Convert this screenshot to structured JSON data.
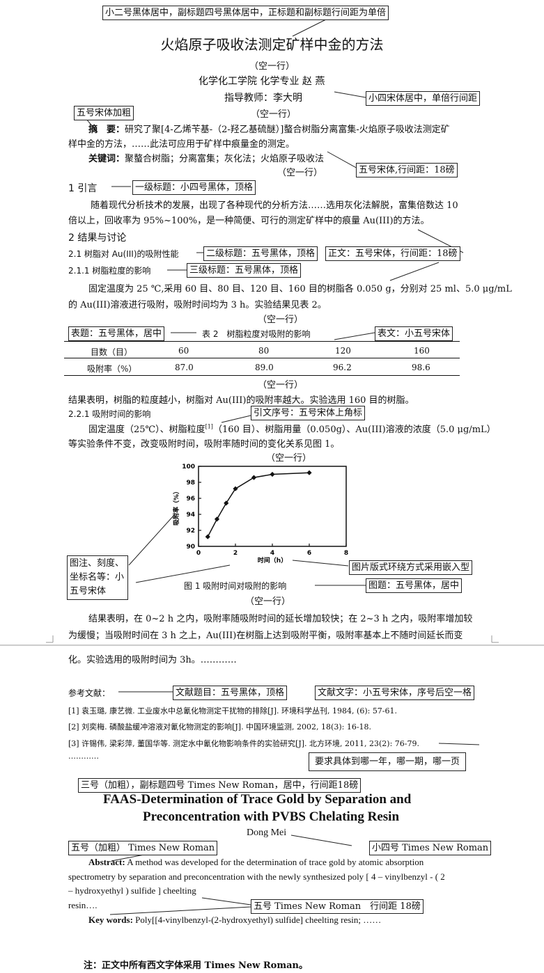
{
  "annotations": {
    "title_style": "小二号黑体居中，副标题四号黑体居中，正标题和副标题行间距为单倍",
    "author_style": "小四宋体居中，单倍行间距",
    "abstract_label_style": "五号宋体加粗",
    "abstract_spacing": "五号宋体,行间距：18磅",
    "level1_heading": "一级标题：小四号黑体，顶格",
    "level2_heading": "二级标题：五号黑体，顶格",
    "body_text_style": "正文：五号宋体，行间距：18磅",
    "level3_heading": "三级标题：五号黑体，顶格",
    "table_title_style": "表题：五号黑体，居中",
    "table_text_style": "表文：小五号宋体",
    "citation_style": "引文序号：五号宋体上角标",
    "figure_label_style": "图注、刻度、坐标名等：小五号宋体",
    "figure_wrap_style": "图片版式环绕方式采用嵌入型",
    "figure_title_style": "图题：五号黑体，居中",
    "ref_title_style": "文献题目：五号黑体，顶格",
    "ref_text_style": "文献文字：小五号宋体，序号后空一格",
    "ref_detail_note": "要求具体到哪一年，哪一期，哪一页",
    "en_title_style": "三号（加粗），副标题四号 Times New Roman，居中，行间距18磅",
    "en_author_style": "小四号 Times New Roman",
    "en_abstract_label_style": "五号（加粗） Times New Roman",
    "en_body_style": "五号 Times New Roman　行间距 18磅"
  },
  "title": "火焰原子吸收法测定矿样中金的方法",
  "blank_line": "（空一行）",
  "affiliation": "化学化工学院  化学专业  赵    燕",
  "advisor": "指导教师：李大明",
  "abstract_label": "摘　要：",
  "abstract_text_1": "研究了聚[4-乙烯苄基-（2-羟乙基硫醚）]螯合树脂分离富集-火焰原子吸收法测定矿",
  "abstract_text_2": "样中金的方法，……此法可应用于矿样中痕量金的测定。",
  "keywords_label": "关键词：",
  "keywords_text": "聚螯合树脂；分离富集；灰化法；火焰原子吸收法",
  "sec1_heading": "1 引言",
  "intro_1": "随着现代分析技术的发展，出现了各种现代的分析方法……选用灰化法解脱，富集倍数达 10",
  "intro_2": "倍以上，回收率为 95%~100%，是一种简便、可行的测定矿样中的痕量 Au(III)的方法。",
  "sec2_heading": "2 结果与讨论",
  "sec21_heading": "2.1 树脂对 Au(III)的吸附性能",
  "sec211_heading": "2.1.1 树脂粒度的影响",
  "p211_1": "固定温度为 25 ℃,采用 60 目、80 目、120 目、160 目的树脂各 0.050 g，分别对 25 ml、5.0 μg/mL",
  "p211_2": "的 Au(III)溶液进行吸附，吸附时间均为 3 h。实验结果见表 2。",
  "table": {
    "caption": "表 2　树脂粒度对吸附的影响",
    "row1_label": "目数（目）",
    "row1": [
      "60",
      "80",
      "120",
      "160"
    ],
    "row2_label": "吸附率（%）",
    "row2": [
      "87.0",
      "89.0",
      "96.2",
      "98.6"
    ]
  },
  "result_211": "结果表明，树脂的粒度越小，树脂对 Au(III)的吸附率越大。实验选用 160 目的树脂。",
  "sec221_heading": "2.2.1 吸附时间的影响",
  "p221_1": "固定温度（25℃）、树脂粒度",
  "p221_cite": "[1]",
  "p221_1b": "（160 目）、树脂用量（0.050g）、Au(III)溶液的浓度（5.0 μg/mL）",
  "p221_2": "等实验条件不变，改变吸附时间，吸附率随时间的变化关系见图 1。",
  "chart_data": {
    "type": "line",
    "x": [
      0.5,
      1,
      1.5,
      2,
      3,
      4,
      6
    ],
    "y": [
      91.2,
      93.4,
      95.4,
      97.2,
      98.6,
      99.0,
      99.2
    ],
    "xlabel": "时间（h）",
    "ylabel": "吸附率（%）",
    "xlim": [
      0,
      8
    ],
    "ylim": [
      90,
      100
    ],
    "xticks": [
      "0",
      "2",
      "4",
      "6",
      "8"
    ],
    "yticks": [
      "90",
      "92",
      "94",
      "96",
      "98",
      "100"
    ],
    "marker": "diamond",
    "grid": false
  },
  "figure_caption": "图 1  吸附时间对吸附的影响",
  "result_221_1": "结果表明，在 0~2 h 之内，吸附率随吸附时间的延长增加较快；在 2~3 h 之内，吸附率增加较",
  "result_221_2": "为缓慢；当吸附时间在 3 h 之上，Au(III)在树脂上达到吸附平衡，吸附率基本上不随时间延长而变",
  "result_221_3": "化。实验选用的吸附时间为 3h。…………",
  "refs_label": "参考文献：",
  "refs": [
    "[1]  袁玉璐, 康艺微. 工业废水中总氰化物测定干扰物的排除[J]. 环境科学丛刊, 1984, (6): 57-61.",
    "[2]  刘奕梅. 磷酸盐缓冲溶液对氰化物测定的影响[J]. 中国环境监测, 2002, 18(3): 16-18.",
    "[3]  许锡伟, 梁彩萍, 董国华等. 测定水中氰化物影响条件的实验研究[J]. 北方环境, 2011, 23(2): 76-79."
  ],
  "refs_ellipsis": "…………",
  "en_title_1": "FAAS-Determination of Trace Gold by Separation and",
  "en_title_2": "Preconcentration with PVBS Chelating Resin",
  "en_author": "Dong Mei",
  "en_abstract_label": "Abstract:",
  "en_abstract_1": "A method was developed for the determination of trace gold by atomic absorption",
  "en_abstract_2": "spectrometry by separation and preconcentration with the   newly synthesized poly [ 4 – vinylbenzyl - ( 2",
  "en_abstract_3": "– hydroxyethyl )   sulfide ]   cheelting",
  "en_abstract_4": "resin….",
  "en_keywords_label": "Key words:",
  "en_keywords_text": "Poly[[4-vinylbenzyl-(2-hydroxyethyl) sulfide] cheelting resin; ……",
  "footnote": "注：正文中所有西文字体采用 Times New Roman。"
}
